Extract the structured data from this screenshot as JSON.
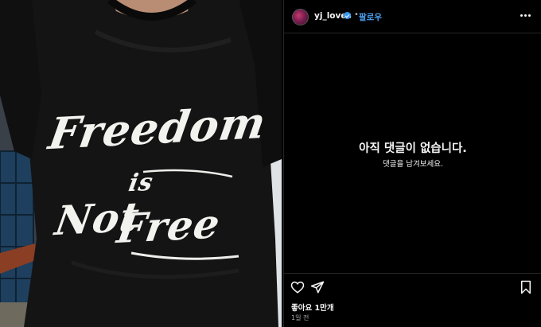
{
  "post": {
    "shirt_text": [
      "Freedom",
      "is",
      "Not",
      "Free"
    ]
  },
  "header": {
    "username": "yj_loves",
    "separator": "•",
    "follow_label": "팔로우",
    "verified_icon": "verified-badge-icon",
    "more_icon": "more-options-icon"
  },
  "comments": {
    "empty_title": "아직 댓글이 없습니다.",
    "empty_subtitle": "댓글을 남겨보세요."
  },
  "actions": {
    "like_icon": "heart-icon",
    "share_icon": "send-icon",
    "save_icon": "bookmark-icon",
    "likes_text": "좋아요 1만개",
    "timestamp": "1일 전"
  },
  "colors": {
    "background": "#000000",
    "follow_blue": "#4aa3f5",
    "verified_blue": "#3897f0",
    "text_secondary": "#a8a8a8"
  }
}
